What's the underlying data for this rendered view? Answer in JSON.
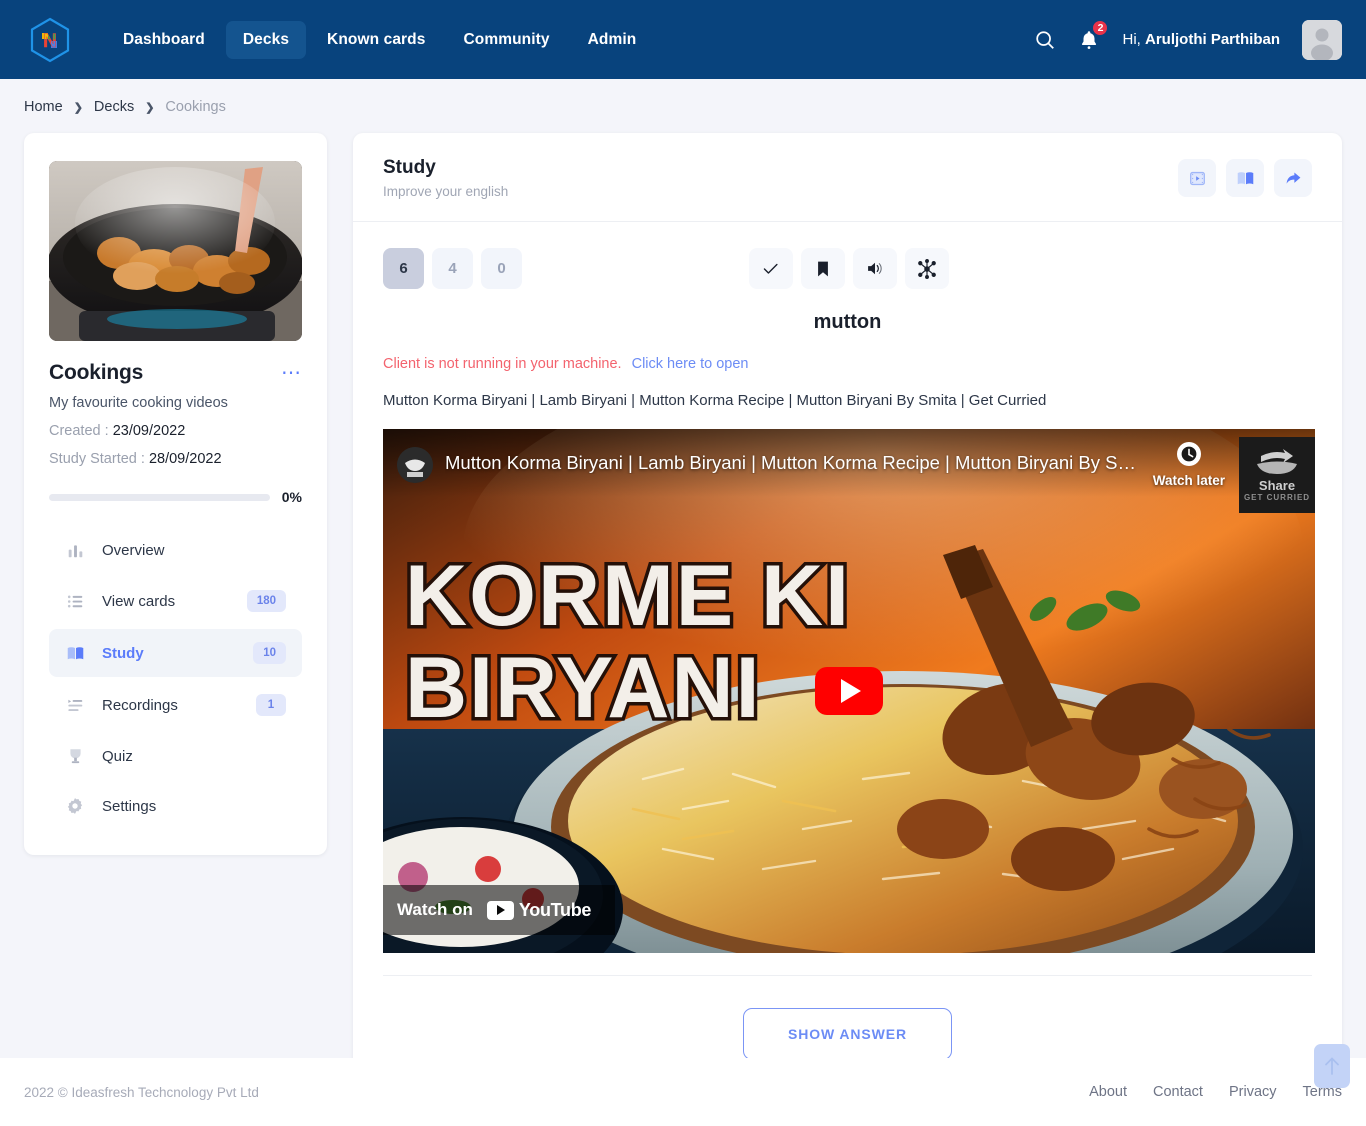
{
  "navbar": {
    "logo_letter": "N",
    "links": [
      {
        "label": "Dashboard",
        "active": false
      },
      {
        "label": "Decks",
        "active": true
      },
      {
        "label": "Known cards",
        "active": false
      },
      {
        "label": "Community",
        "active": false
      },
      {
        "label": "Admin",
        "active": false
      }
    ],
    "notification_count": "2",
    "greeting_prefix": "Hi,",
    "user_name": "Aruljothi Parthiban"
  },
  "breadcrumb": {
    "home": "Home",
    "decks": "Decks",
    "current": "Cookings",
    "separator": "›"
  },
  "deck": {
    "title": "Cookings",
    "description": "My favourite cooking videos",
    "created_label": "Created :",
    "created_value": "23/09/2022",
    "study_started_label": "Study Started :",
    "study_started_value": "28/09/2022",
    "progress_percent": "0%",
    "progress_value": 0,
    "menu": [
      {
        "label": "Overview",
        "icon": "bar-chart-icon",
        "badge": null,
        "active": false
      },
      {
        "label": "View cards",
        "icon": "list-icon",
        "badge": "180",
        "active": false
      },
      {
        "label": "Study",
        "icon": "book-icon",
        "badge": "10",
        "active": true
      },
      {
        "label": "Recordings",
        "icon": "recordings-icon",
        "badge": "1",
        "active": false
      },
      {
        "label": "Quiz",
        "icon": "trophy-icon",
        "badge": null,
        "active": false
      },
      {
        "label": "Settings",
        "icon": "gear-icon",
        "badge": null,
        "active": false
      }
    ]
  },
  "study": {
    "title": "Study",
    "subtitle": "Improve your english",
    "header_actions": [
      {
        "name": "video-mode-button",
        "icon": "film-icon"
      },
      {
        "name": "book-mode-button",
        "icon": "book-icon"
      },
      {
        "name": "share-button",
        "icon": "share-arrow-icon"
      }
    ],
    "counters": [
      {
        "value": "6",
        "selected": true
      },
      {
        "value": "4",
        "selected": false
      },
      {
        "value": "0",
        "selected": false
      }
    ],
    "card_actions": [
      {
        "name": "mark-known-button",
        "icon": "check-icon"
      },
      {
        "name": "bookmark-button",
        "icon": "bookmark-icon"
      },
      {
        "name": "speak-button",
        "icon": "speaker-icon"
      },
      {
        "name": "connections-button",
        "icon": "network-icon"
      }
    ],
    "word": "mutton",
    "warning_text": "Client is not running in your machine.",
    "warning_link": "Click here to open",
    "video_caption": "Mutton Korma Biryani | Lamb Biryani | Mutton Korma Recipe | Mutton Biryani By Smita | Get Curried",
    "show_answer_label": "SHOW ANSWER"
  },
  "video": {
    "yt_title": "Mutton Korma Biryani | Lamb Biryani | Mutton Korma Recipe | Mutton Biryani By Smita ...",
    "thumbnail_text_line1": "KORME KI",
    "thumbnail_text_line2": "BIRYANI",
    "watch_later": "Watch later",
    "share": "Share",
    "channel_watermark": "GET CURRIED",
    "watch_on": "Watch on",
    "platform": "YouTube"
  },
  "footer": {
    "copyright": "2022 © Ideasfresh Techcnology Pvt Ltd",
    "links": [
      "About",
      "Contact",
      "Privacy",
      "Terms"
    ]
  },
  "colors": {
    "navbar_bg": "#08437d",
    "accent": "#5b7cfa",
    "danger": "#f3636e",
    "youtube_red": "#ff0000",
    "badge_red": "#e8334a"
  }
}
